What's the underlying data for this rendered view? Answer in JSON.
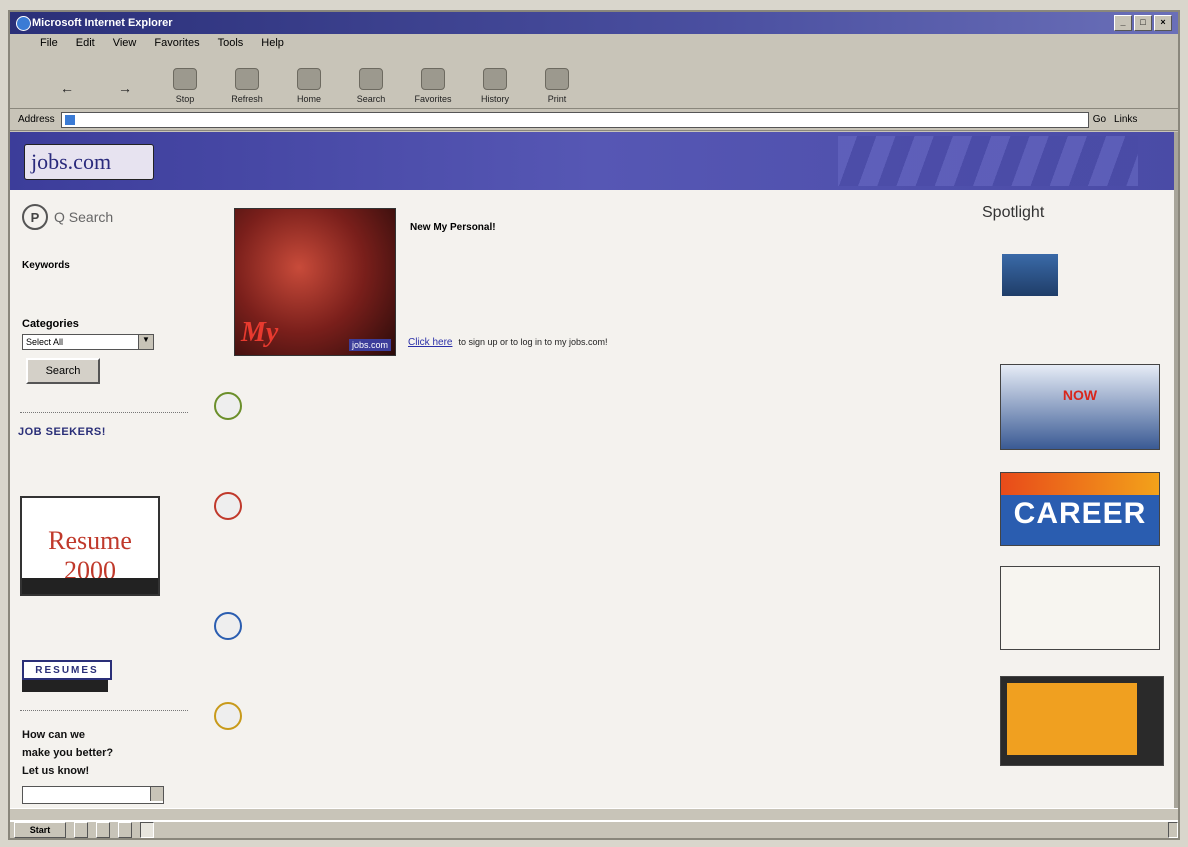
{
  "window": {
    "title": "Microsoft Internet Explorer"
  },
  "menu": [
    "File",
    "Edit",
    "View",
    "Favorites",
    "Tools",
    "Help"
  ],
  "toolbar": [
    {
      "label": "",
      "icon": "back-arrow-icon"
    },
    {
      "label": "",
      "icon": "forward-arrow-icon"
    },
    {
      "label": "Stop",
      "icon": "stop-icon"
    },
    {
      "label": "Refresh",
      "icon": "refresh-icon"
    },
    {
      "label": "Home",
      "icon": "home-icon"
    },
    {
      "label": "Search",
      "icon": "search-icon"
    },
    {
      "label": "Favorites",
      "icon": "favorites-icon"
    },
    {
      "label": "History",
      "icon": "history-icon"
    },
    {
      "label": "Print",
      "icon": "print-icon"
    }
  ],
  "address": {
    "label": "Address",
    "url": "",
    "go": "Go",
    "links": "Links"
  },
  "site": {
    "logo": "jobs.com",
    "search_brand": "Q Search",
    "keywords_label": "Keywords",
    "categories_label": "Categories",
    "categories_value": "Select All",
    "search_button": "Search",
    "job_seekers_title": "JOB SEEKERS!",
    "job_seekers_text": "",
    "resume_sub": "",
    "resume_title": "Resume 2000",
    "employers_title": "",
    "employers_text": "",
    "resumes_badge": "RESUMES",
    "help_line1": "How can we",
    "help_line2": "make you better?",
    "help_line3": "Let us know!"
  },
  "promo": {
    "title": "New My Personal!",
    "text": "",
    "click_link": "Click here",
    "click_rest": "to sign up or to log in to my jobs.com!",
    "photo_my": "My",
    "photo_brand": "jobs.com"
  },
  "sections": [
    {
      "title": "",
      "desc": "",
      "links": [],
      "color": "#6b8f2a"
    },
    {
      "title": "",
      "desc": "",
      "links": [],
      "color": "#c0392b"
    },
    {
      "title": "",
      "desc": "",
      "links": [],
      "color": "#2a5db0"
    },
    {
      "title": "",
      "desc": "",
      "links": [],
      "color": "#c89a1a"
    }
  ],
  "spotlight": {
    "title": "Spotlight",
    "ad1_text": "",
    "ad2_line1": "",
    "ad2_line2": "NOW",
    "ad3_label": "",
    "ad3_word": "CAREER",
    "ad4_text": "",
    "ad5_text": ""
  },
  "statusbar": {
    "text": "",
    "zone": ""
  },
  "taskbar": {
    "start": "Start",
    "tasks": [
      "",
      "",
      "",
      ""
    ],
    "tray": ""
  }
}
